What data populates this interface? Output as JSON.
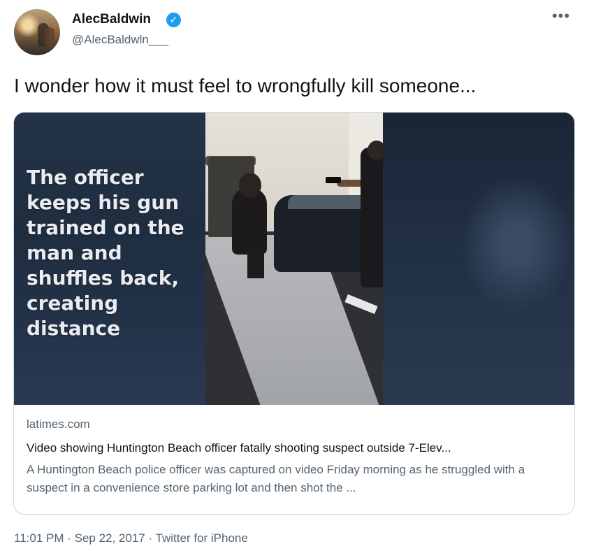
{
  "author": {
    "display_name": "AlecBaldwin",
    "handle": "@AlecBaldwln___",
    "verified": true
  },
  "tweet": {
    "text": "I wonder how it must feel to wrongfully kill someone...",
    "more_icon": "more-horizontal-icon"
  },
  "card": {
    "overlay_text": "The officer keeps his gun trained on the man and shuffles back, creating distance",
    "domain": "latimes.com",
    "title": "Video showing Huntington Beach officer fatally shooting suspect outside 7-Elev...",
    "description": "A Huntington Beach police officer was captured on video Friday morning as he struggled with a suspect in a convenience store parking lot and then shot the ..."
  },
  "footer": {
    "timestamp": "11:01 PM · Sep 22, 2017 · Twitter for iPhone"
  },
  "colors": {
    "verified_badge": "#1d9bf0",
    "secondary_text": "#536471",
    "primary_text": "#0f1419",
    "card_border": "#cfd9de"
  }
}
